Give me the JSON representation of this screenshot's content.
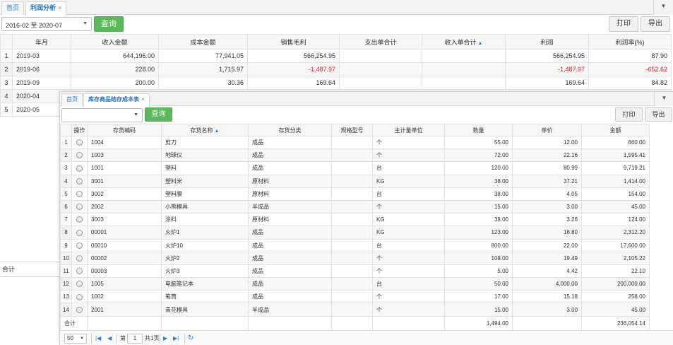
{
  "profit": {
    "tabs": [
      {
        "label": "首页"
      },
      {
        "label": "利润分析",
        "close": "×"
      }
    ],
    "date_range": "2016-02 至 2020-07",
    "query_label": "查询",
    "print_label": "打印",
    "export_label": "导出",
    "columns": [
      "年月",
      "收入金额",
      "成本金额",
      "销售毛利",
      "支出单合计",
      "收入单合计",
      "利润",
      "利润率(%)"
    ],
    "rows": [
      {
        "idx": "1",
        "month": "2019-03",
        "revenue": "644,196.00",
        "cost": "77,941.05",
        "gross": "566,254.95",
        "expense": "",
        "income": "",
        "profit": "566,254.95",
        "rate": "87.90"
      },
      {
        "idx": "2",
        "month": "2019-06",
        "revenue": "228.00",
        "cost": "1,715.97",
        "gross": "-1,487.97",
        "expense": "",
        "income": "",
        "profit": "-1,487.97",
        "rate": "-652.62"
      },
      {
        "idx": "3",
        "month": "2019-09",
        "revenue": "200.00",
        "cost": "30.36",
        "gross": "169.64",
        "expense": "",
        "income": "",
        "profit": "169.64",
        "rate": "84.82"
      },
      {
        "idx": "4",
        "month": "2020-04"
      },
      {
        "idx": "5",
        "month": "2020-05"
      }
    ],
    "total_label": "合计"
  },
  "inventory": {
    "tabs": [
      {
        "label": "首页"
      },
      {
        "label": "库存商品结存成本表",
        "close": "×"
      }
    ],
    "select_value": "",
    "query_label": "查询",
    "print_label": "打印",
    "export_label": "导出",
    "columns": [
      "操作",
      "存货编码",
      "存货名称",
      "存货分类",
      "规格型号",
      "主计量单位",
      "数量",
      "单价",
      "金额"
    ],
    "rows": [
      {
        "idx": "1",
        "code": "1004",
        "name": "剪刀",
        "cat": "成品",
        "spec": "",
        "unit": "个",
        "qty": "55.00",
        "price": "12.00",
        "amount": "660.00"
      },
      {
        "idx": "2",
        "code": "1003",
        "name": "地球仪",
        "cat": "成品",
        "spec": "",
        "unit": "个",
        "qty": "72.00",
        "price": "22.16",
        "amount": "1,595.41"
      },
      {
        "idx": "3",
        "code": "1001",
        "name": "塑料",
        "cat": "成品",
        "spec": "",
        "unit": "台",
        "qty": "120.00",
        "price": "80.99",
        "amount": "9,719.21"
      },
      {
        "idx": "4",
        "code": "3001",
        "name": "塑料米",
        "cat": "原材料",
        "spec": "",
        "unit": "KG",
        "qty": "38.00",
        "price": "37.21",
        "amount": "1,414.00"
      },
      {
        "idx": "5",
        "code": "3002",
        "name": "塑料膜",
        "cat": "原材料",
        "spec": "",
        "unit": "台",
        "qty": "38.00",
        "price": "4.05",
        "amount": "154.00"
      },
      {
        "idx": "6",
        "code": "2002",
        "name": "小熊模具",
        "cat": "半成品",
        "spec": "",
        "unit": "个",
        "qty": "15.00",
        "price": "3.00",
        "amount": "45.00"
      },
      {
        "idx": "7",
        "code": "3003",
        "name": "涂料",
        "cat": "原材料",
        "spec": "",
        "unit": "KG",
        "qty": "38.00",
        "price": "3.26",
        "amount": "124.00"
      },
      {
        "idx": "8",
        "code": "00001",
        "name": "火炉1",
        "cat": "成品",
        "spec": "",
        "unit": "KG",
        "qty": "123.00",
        "price": "18.80",
        "amount": "2,312.20"
      },
      {
        "idx": "9",
        "code": "00010",
        "name": "火炉10",
        "cat": "成品",
        "spec": "",
        "unit": "台",
        "qty": "800.00",
        "price": "22.00",
        "amount": "17,600.00"
      },
      {
        "idx": "10",
        "code": "00002",
        "name": "火炉2",
        "cat": "成品",
        "spec": "",
        "unit": "个",
        "qty": "108.00",
        "price": "19.49",
        "amount": "2,105.22"
      },
      {
        "idx": "11",
        "code": "00003",
        "name": "火炉3",
        "cat": "成品",
        "spec": "",
        "unit": "个",
        "qty": "5.00",
        "price": "4.42",
        "amount": "22.10"
      },
      {
        "idx": "12",
        "code": "1005",
        "name": "电脑笔记本",
        "cat": "成品",
        "spec": "",
        "unit": "台",
        "qty": "50.00",
        "price": "4,000.00",
        "amount": "200,000.00"
      },
      {
        "idx": "13",
        "code": "1002",
        "name": "笔筒",
        "cat": "成品",
        "spec": "",
        "unit": "个",
        "qty": "17.00",
        "price": "15.18",
        "amount": "258.00"
      },
      {
        "idx": "14",
        "code": "2001",
        "name": "青花模具",
        "cat": "半成品",
        "spec": "",
        "unit": "个",
        "qty": "15.00",
        "price": "3.00",
        "amount": "45.00"
      }
    ],
    "total": {
      "label": "合计",
      "qty": "1,494.00",
      "amount": "236,054.14"
    },
    "pager": {
      "page_size": "50",
      "page_prefix": "第",
      "page": "1",
      "page_suffix": "共1页"
    }
  },
  "icons": {
    "dropdown": "chevron-down-icon",
    "first": "first-page-icon",
    "prev": "prev-page-icon",
    "next": "next-page-icon",
    "last": "last-page-icon",
    "refresh": "refresh-icon"
  },
  "colors": {
    "accent": "#2a7fd4",
    "query_green": "#5cb85c",
    "negative": "#e02020"
  }
}
